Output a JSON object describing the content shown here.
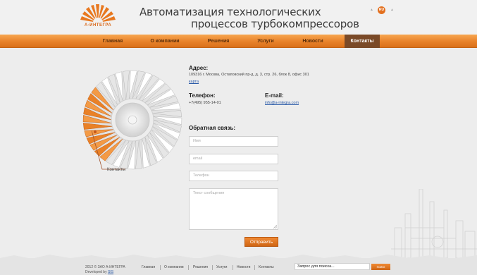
{
  "header": {
    "logo_text": "А-ИНТЕГРА",
    "tagline_line1": "Автоматизация технологических",
    "tagline_line2": "процессов турбокомпрессоров",
    "lang_active": "RU"
  },
  "nav": {
    "items": [
      {
        "label": "Главная"
      },
      {
        "label": "О компании"
      },
      {
        "label": "Решения"
      },
      {
        "label": "Услуги"
      },
      {
        "label": "Новости"
      },
      {
        "label": "Контакты"
      }
    ],
    "active": "Контакты"
  },
  "turbine": {
    "caption": "Контакты"
  },
  "contacts": {
    "address_label": "Адрес:",
    "address_text": "109316 г. Москва, Остаповский пр-д, д. 3, стр. 26, блок 8, офис 301",
    "map_link": "карта",
    "phone_label": "Телефон:",
    "phone_value": "+7(495) 955-14-01",
    "email_label": "E-mail:",
    "email_value": "info@a-integra.com"
  },
  "feedback": {
    "title": "Обратная связь:",
    "name_placeholder": "Имя",
    "email_placeholder": "email",
    "phone_placeholder": "Телефон",
    "message_placeholder": "Текст сообщения",
    "submit_label": "Отправить"
  },
  "footer": {
    "copyright": "2012 © ЗАО А-ИНТЕГРА",
    "developed_by": "Developed by",
    "developer": "SIS",
    "nav": [
      "Главная",
      "О компании",
      "Решения",
      "Услуги",
      "Новости",
      "Контакты"
    ],
    "search_value": "Запрос для поиска...",
    "search_button": "поиск"
  },
  "colors": {
    "accent": "#e8822a",
    "nav_active": "#7a4a28",
    "link": "#2a5aa8"
  }
}
